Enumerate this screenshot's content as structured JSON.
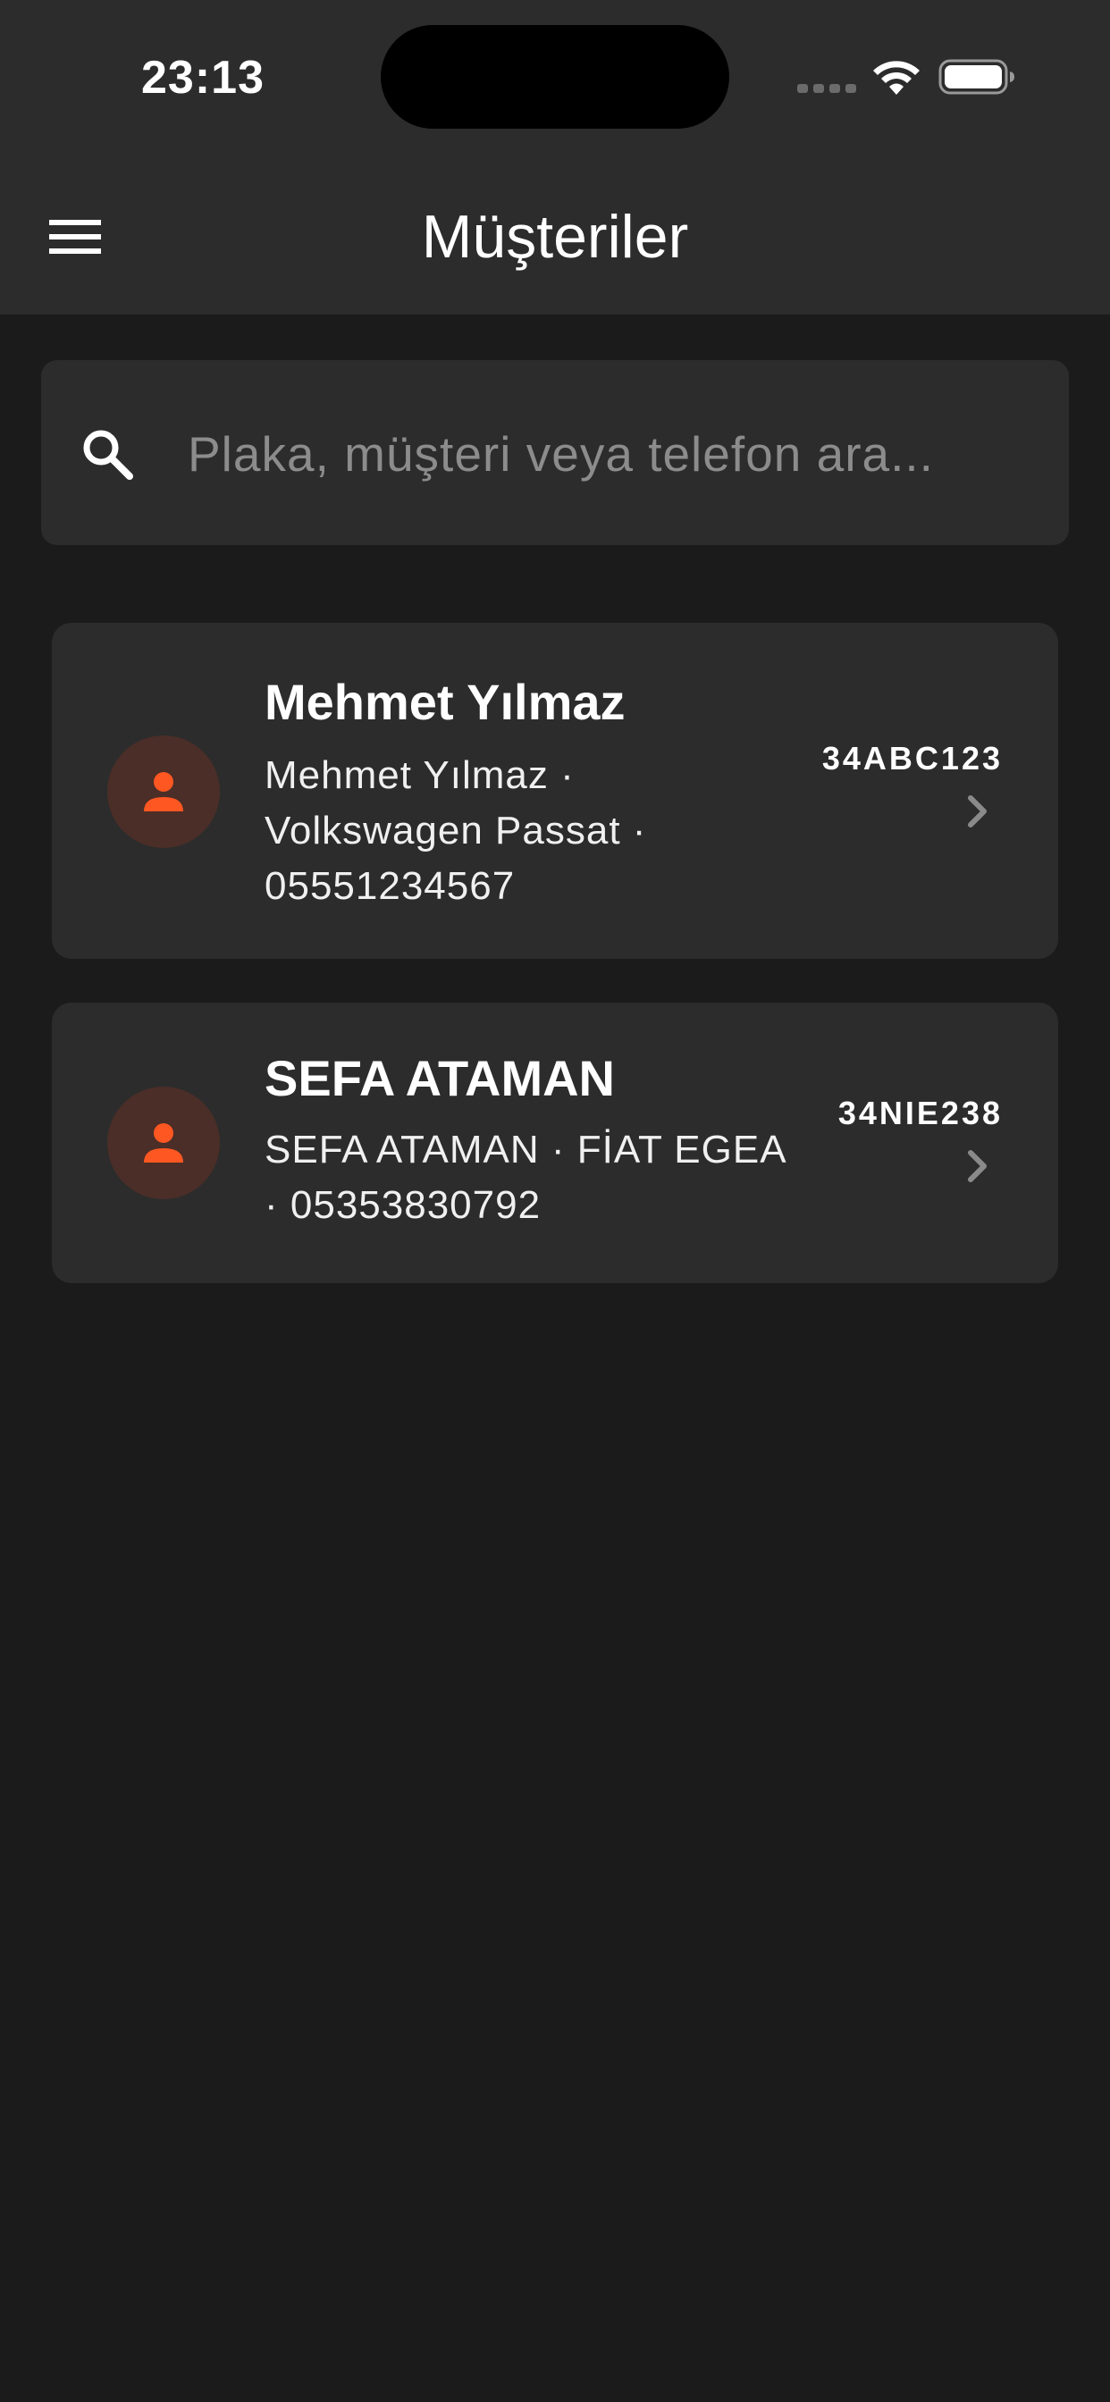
{
  "status_bar": {
    "time": "23:13"
  },
  "header": {
    "title": "Müşteriler",
    "menu_icon": "hamburger-menu-icon"
  },
  "search": {
    "placeholder": "Plaka, müşteri veya telefon ara...",
    "value": "",
    "icon": "search-icon"
  },
  "customers": [
    {
      "name": "Mehmet Yılmaz",
      "detail": "Mehmet Yılmaz · Volkswagen Passat · 05551234567",
      "plate": "34ABC123"
    },
    {
      "name": "SEFA ATAMAN",
      "detail": "SEFA ATAMAN · FİAT EGEA · 05353830792",
      "plate": "34NIE238"
    }
  ],
  "colors": {
    "background": "#1b1b1b",
    "surface": "#2c2c2c",
    "accent": "#ff5722",
    "avatar_bg": "#4a2e27"
  }
}
